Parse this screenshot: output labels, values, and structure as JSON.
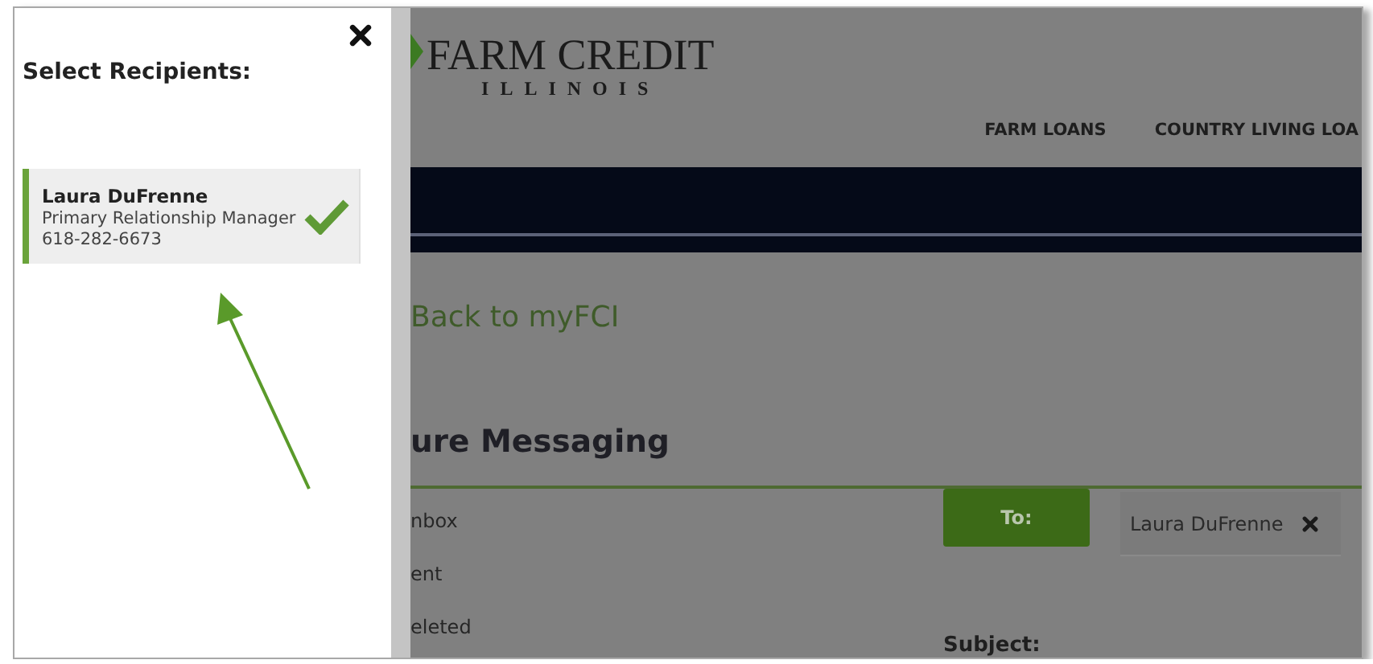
{
  "panel": {
    "title": "Select Recipients:",
    "recipients": [
      {
        "name": "Laura DuFrenne",
        "role": "Primary Relationship Manager",
        "phone": "618-282-6673",
        "selected": true
      }
    ]
  },
  "header": {
    "logo_title": "FARM CREDIT",
    "logo_subtitle": "ILLINOIS",
    "nav": [
      "FARM LOANS",
      "COUNTRY LIVING LOA"
    ]
  },
  "back_link": "Back to myFCI",
  "heading": "ure Messaging",
  "folders": [
    "nbox",
    "ent",
    "eleted"
  ],
  "to_button": "To:",
  "to_recipients": [
    {
      "name": "Laura DuFrenne"
    }
  ],
  "subject_label": "Subject:"
}
